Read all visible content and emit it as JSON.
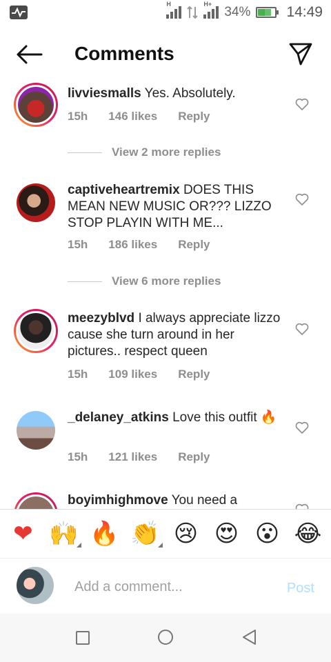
{
  "status_bar": {
    "battery_percent": "34%",
    "time": "14:49",
    "signal1_label": "H",
    "signal2_label": "H+",
    "icons": [
      "app-notification-icon",
      "signal-icon",
      "data-arrows-icon",
      "signal-icon",
      "battery-charging-icon"
    ]
  },
  "header": {
    "title": "Comments",
    "back_icon": "arrow-left-icon",
    "send_icon": "paper-plane-icon"
  },
  "comments": [
    {
      "user": "livviesmalls",
      "text": "Yes. Absolutely.",
      "time": "15h",
      "likes": "146 likes",
      "reply": "Reply"
    },
    {
      "user": "captiveheartremix",
      "text": "DOES THIS MEAN NEW MUSIC OR??? LIZZO STOP PLAYIN WITH ME...",
      "time": "15h",
      "likes": "186 likes",
      "reply": "Reply"
    },
    {
      "user": "meezyblvd",
      "text": "I always appreciate lizzo cause she turn around in her pictures.. respect queen",
      "time": "15h",
      "likes": "109 likes",
      "reply": "Reply"
    },
    {
      "user": "_delaney_atkins",
      "text": "Love this outfit 🔥",
      "time": "15h",
      "likes": "121 likes",
      "reply": "Reply"
    },
    {
      "user": "boyimhighmove",
      "text": "You need a"
    }
  ],
  "view_more": [
    "View 2 more replies",
    "View 6 more replies"
  ],
  "emoji_bar": [
    "❤",
    "🙌",
    "🔥",
    "👏",
    "😢",
    "😍",
    "😮",
    "😂"
  ],
  "compose": {
    "placeholder": "Add a comment...",
    "post_label": "Post"
  },
  "colors": {
    "accent_post": "#b2dffc",
    "meta_gray": "#8e8e8e",
    "ring_gradient": [
      "#f9a825",
      "#e91e63"
    ]
  }
}
